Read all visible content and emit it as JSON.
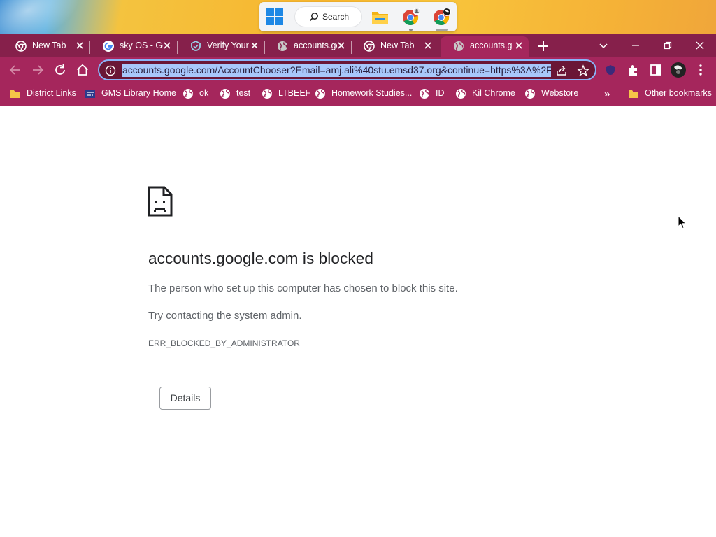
{
  "taskbar": {
    "search_label": "Search",
    "apps": [
      "windows-start-icon",
      "file-explorer-icon",
      "chrome-profile-icon",
      "chrome-profile-icon"
    ]
  },
  "browser": {
    "tabs": [
      {
        "title": "New Tab",
        "icon": "chrome-icon",
        "active": false
      },
      {
        "title": "sky OS - Go",
        "icon": "google-icon",
        "active": false
      },
      {
        "title": "Verify Your",
        "icon": "verify-icon",
        "active": false
      },
      {
        "title": "accounts.go",
        "icon": "globe-icon",
        "active": false
      },
      {
        "title": "New Tab",
        "icon": "chrome-icon",
        "active": false
      },
      {
        "title": "accounts.go",
        "icon": "globe-icon",
        "active": true
      }
    ],
    "address": "accounts.google.com/AccountChooser?Email=amj.ali%40stu.emsd37.org&continue=https%3A%2F",
    "bookmarks": [
      {
        "label": "District Links",
        "icon": "folder-icon"
      },
      {
        "label": "GMS Library Home",
        "icon": "library-icon"
      },
      {
        "label": "ok",
        "icon": "globe-icon"
      },
      {
        "label": "test",
        "icon": "globe-icon"
      },
      {
        "label": "LTBEEF",
        "icon": "globe-icon"
      },
      {
        "label": "Homework Studies...",
        "icon": "globe-icon"
      },
      {
        "label": "ID",
        "icon": "globe-icon"
      },
      {
        "label": "Kil Chrome",
        "icon": "globe-icon"
      },
      {
        "label": "Webstore",
        "icon": "globe-icon"
      }
    ],
    "other_bookmarks": "Other bookmarks",
    "more_bookmarks": "»"
  },
  "error": {
    "title": "accounts.google.com is blocked",
    "message": "The person who set up this computer has chosen to block this site.",
    "suggestion": "Try contacting the system admin.",
    "code": "ERR_BLOCKED_BY_ADMINISTRATOR",
    "details_label": "Details"
  },
  "colors": {
    "frame": "#86204b",
    "toolbar": "#a5265c",
    "omnibox": "#6a1636",
    "selection": "#a8c7fa"
  }
}
